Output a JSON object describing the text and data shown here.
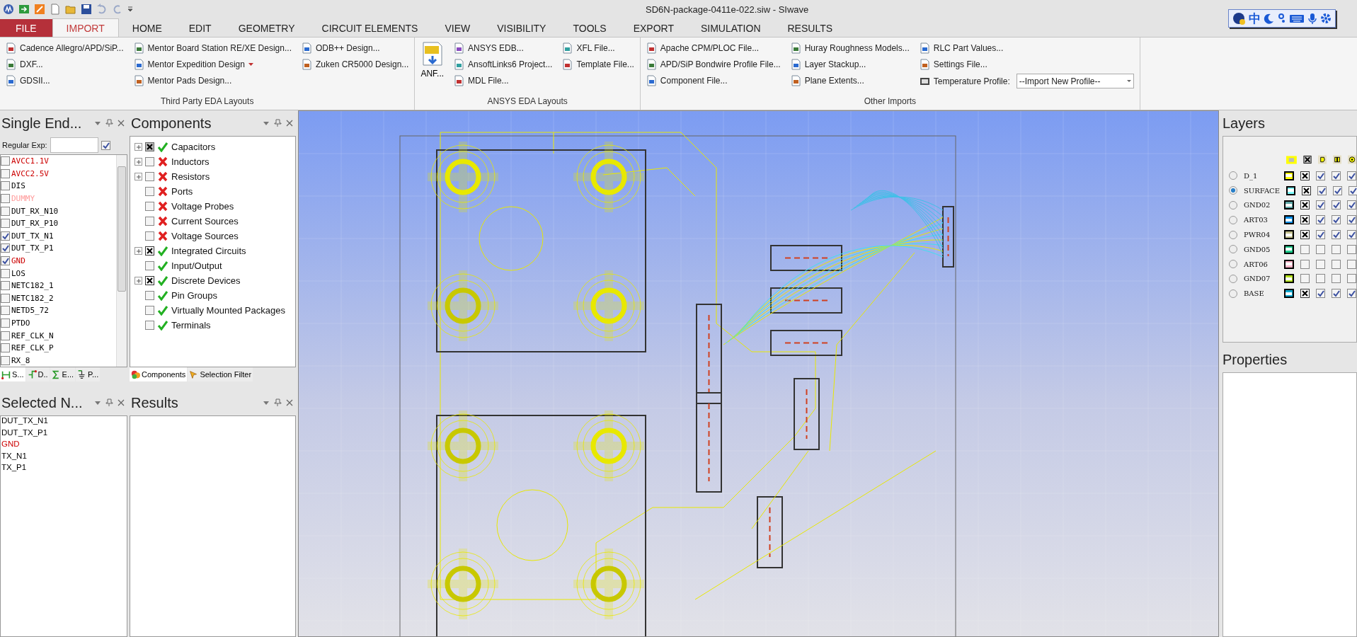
{
  "title_bar": {
    "title": "SD6N-package-0411e-022.siw - SIwave",
    "ime_mode": "中"
  },
  "ribbon_tabs": [
    {
      "label": "FILE",
      "kind": "file",
      "selected": false
    },
    {
      "label": "IMPORT",
      "kind": "tab",
      "selected": true
    },
    {
      "label": "HOME",
      "kind": "tab",
      "selected": false
    },
    {
      "label": "EDIT",
      "kind": "tab",
      "selected": false
    },
    {
      "label": "GEOMETRY",
      "kind": "tab",
      "selected": false
    },
    {
      "label": "CIRCUIT ELEMENTS",
      "kind": "tab",
      "selected": false
    },
    {
      "label": "VIEW",
      "kind": "tab",
      "selected": false
    },
    {
      "label": "VISIBILITY",
      "kind": "tab",
      "selected": false
    },
    {
      "label": "TOOLS",
      "kind": "tab",
      "selected": false
    },
    {
      "label": "EXPORT",
      "kind": "tab",
      "selected": false
    },
    {
      "label": "SIMULATION",
      "kind": "tab",
      "selected": false
    },
    {
      "label": "RESULTS",
      "kind": "tab",
      "selected": false
    }
  ],
  "ribbon_groups": [
    {
      "label": "Third Party EDA Layouts",
      "columns": [
        [
          {
            "kind": "button",
            "label": "Cadence Allegro/APD/SiP..."
          },
          {
            "kind": "button",
            "label": "DXF..."
          },
          {
            "kind": "button",
            "label": "GDSII..."
          }
        ],
        [
          {
            "kind": "button",
            "label": "Mentor Board Station RE/XE Design..."
          },
          {
            "kind": "menu",
            "label": "Mentor Expedition Design"
          },
          {
            "kind": "button",
            "label": "Mentor Pads Design..."
          }
        ],
        [
          {
            "kind": "button",
            "label": "ODB++ Design..."
          },
          {
            "kind": "button",
            "label": "Zuken CR5000 Design..."
          }
        ]
      ]
    },
    {
      "label": "ANSYS EDA Layouts",
      "columns": [
        [
          {
            "kind": "big",
            "label": "ANF..."
          }
        ],
        [
          {
            "kind": "button",
            "label": "ANSYS EDB..."
          },
          {
            "kind": "button",
            "label": "AnsoftLinks6 Project..."
          },
          {
            "kind": "button",
            "label": "MDL File..."
          }
        ],
        [
          {
            "kind": "button",
            "label": "XFL File..."
          },
          {
            "kind": "button",
            "label": "Template File..."
          }
        ]
      ]
    },
    {
      "label": "Other Imports",
      "columns": [
        [
          {
            "kind": "button",
            "label": "Apache CPM/PLOC File..."
          },
          {
            "kind": "button",
            "label": "APD/SiP Bondwire Profile File..."
          },
          {
            "kind": "button",
            "label": "Component File..."
          }
        ],
        [
          {
            "kind": "button",
            "label": "Huray Roughness Models..."
          },
          {
            "kind": "button",
            "label": "Layer Stackup..."
          },
          {
            "kind": "button",
            "label": "Plane Extents..."
          }
        ],
        [
          {
            "kind": "button",
            "label": "RLC Part Values..."
          },
          {
            "kind": "button",
            "label": "Settings File..."
          },
          {
            "kind": "dropdown",
            "label": "Temperature Profile:",
            "value": "--Import New Profile--"
          }
        ]
      ]
    }
  ],
  "nets_panel": {
    "title": "Single End...",
    "regex_label": "Regular Exp:",
    "regex_enabled": true,
    "nets": [
      {
        "name": "AVCC1.1V",
        "checked": false,
        "color": "#cc0000"
      },
      {
        "name": "AVCC2.5V",
        "checked": false,
        "color": "#cc0000"
      },
      {
        "name": "DIS",
        "checked": false,
        "color": "#000000"
      },
      {
        "name": "DUMMY",
        "checked": false,
        "color": "#ff9a9a"
      },
      {
        "name": "DUT_RX_N10",
        "checked": false,
        "color": "#000000"
      },
      {
        "name": "DUT_RX_P10",
        "checked": false,
        "color": "#000000"
      },
      {
        "name": "DUT_TX_N1",
        "checked": true,
        "color": "#000000"
      },
      {
        "name": "DUT_TX_P1",
        "checked": true,
        "color": "#000000"
      },
      {
        "name": "GND",
        "checked": true,
        "color": "#cc0000"
      },
      {
        "name": "LOS",
        "checked": false,
        "color": "#000000"
      },
      {
        "name": "NETC182_1",
        "checked": false,
        "color": "#000000"
      },
      {
        "name": "NETC182_2",
        "checked": false,
        "color": "#000000"
      },
      {
        "name": "NETD5_72",
        "checked": false,
        "color": "#000000"
      },
      {
        "name": "PTDO",
        "checked": false,
        "color": "#000000"
      },
      {
        "name": "REF_CLK_N",
        "checked": false,
        "color": "#000000"
      },
      {
        "name": "REF_CLK_P",
        "checked": false,
        "color": "#000000"
      },
      {
        "name": "RX_8",
        "checked": false,
        "color": "#000000"
      }
    ],
    "tabs": [
      {
        "label": "S...",
        "selected": true
      },
      {
        "label": "D..",
        "selected": false
      },
      {
        "label": "E...",
        "selected": false
      },
      {
        "label": "P...",
        "selected": false
      }
    ]
  },
  "components_panel": {
    "title": "Components",
    "items": [
      {
        "label": "Capacitors",
        "expandable": true,
        "checked": true,
        "partial": true,
        "enabled": true
      },
      {
        "label": "Inductors",
        "expandable": true,
        "checked": false,
        "partial": false,
        "enabled": false
      },
      {
        "label": "Resistors",
        "expandable": true,
        "checked": false,
        "partial": false,
        "enabled": false
      },
      {
        "label": "Ports",
        "expandable": false,
        "checked": false,
        "partial": false,
        "enabled": false
      },
      {
        "label": "Voltage Probes",
        "expandable": false,
        "checked": false,
        "partial": false,
        "enabled": false
      },
      {
        "label": "Current Sources",
        "expandable": false,
        "checked": false,
        "partial": false,
        "enabled": false
      },
      {
        "label": "Voltage Sources",
        "expandable": false,
        "checked": false,
        "partial": false,
        "enabled": false
      },
      {
        "label": "Integrated Circuits",
        "expandable": true,
        "checked": true,
        "partial": false,
        "enabled": true
      },
      {
        "label": "Input/Output",
        "expandable": false,
        "checked": false,
        "partial": false,
        "enabled": true
      },
      {
        "label": "Discrete Devices",
        "expandable": true,
        "checked": true,
        "partial": false,
        "enabled": true
      },
      {
        "label": "Pin Groups",
        "expandable": false,
        "checked": false,
        "partial": false,
        "enabled": true
      },
      {
        "label": "Virtually Mounted Packages",
        "expandable": false,
        "checked": false,
        "partial": false,
        "enabled": true
      },
      {
        "label": "Terminals",
        "expandable": false,
        "checked": false,
        "partial": false,
        "enabled": true
      }
    ],
    "tabs": [
      {
        "label": "Components",
        "selected": true
      },
      {
        "label": "Selection Filter",
        "selected": false
      }
    ]
  },
  "selected_nets_panel": {
    "title": "Selected N...",
    "nets": [
      {
        "name": "DUT_TX_N1",
        "color": "#000000"
      },
      {
        "name": "DUT_TX_P1",
        "color": "#000000"
      },
      {
        "name": "GND",
        "color": "#cc0000"
      },
      {
        "name": "TX_N1",
        "color": "#000000"
      },
      {
        "name": "TX_P1",
        "color": "#000000"
      }
    ]
  },
  "results_panel": {
    "title": "Results"
  },
  "layers_panel": {
    "title": "Layers",
    "layers": [
      {
        "name": "D_1",
        "selected": false,
        "color": "#ffff00",
        "visible": true,
        "col_3": true,
        "col_4": true,
        "col_5": true
      },
      {
        "name": "SURFACE",
        "selected": true,
        "color": "#80ffff",
        "visible": true,
        "col_3": true,
        "col_4": true,
        "col_5": true
      },
      {
        "name": "GND02",
        "selected": false,
        "color": "#5fa8a8",
        "visible": true,
        "col_3": true,
        "col_4": true,
        "col_5": true
      },
      {
        "name": "ART03",
        "selected": false,
        "color": "#0a8ee8",
        "visible": true,
        "col_3": true,
        "col_4": true,
        "col_5": true
      },
      {
        "name": "PWR04",
        "selected": false,
        "color": "#c4c08e",
        "visible": true,
        "col_3": true,
        "col_4": true,
        "col_5": true
      },
      {
        "name": "GND05",
        "selected": false,
        "color": "#1ecb8c",
        "visible": false,
        "col_3": false,
        "col_4": false,
        "col_5": false
      },
      {
        "name": "ART06",
        "selected": false,
        "color": "#ffb4c8",
        "visible": false,
        "col_3": false,
        "col_4": false,
        "col_5": false
      },
      {
        "name": "GND07",
        "selected": false,
        "color": "#b4e01e",
        "visible": false,
        "col_3": false,
        "col_4": false,
        "col_5": false
      },
      {
        "name": "BASE",
        "selected": false,
        "color": "#10a8d0",
        "visible": true,
        "col_3": true,
        "col_4": true,
        "col_5": true
      }
    ]
  },
  "properties_panel": {
    "title": "Properties"
  }
}
